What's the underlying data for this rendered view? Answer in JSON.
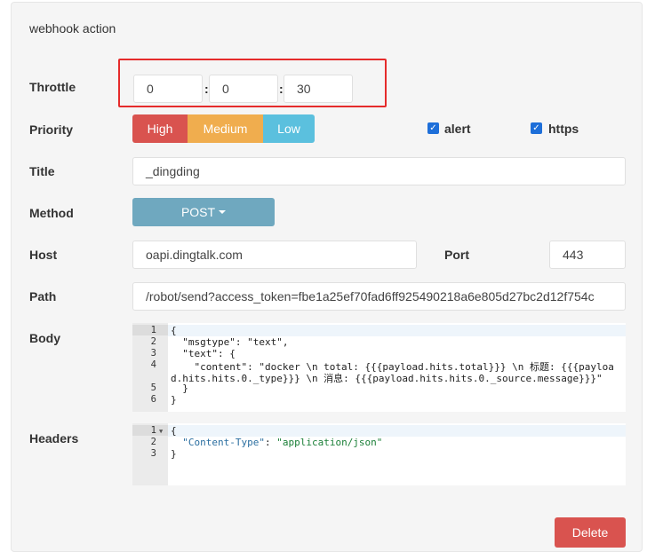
{
  "panel": {
    "title": "webhook action"
  },
  "throttle": {
    "label": "Throttle",
    "hours": "0",
    "minutes": "0",
    "seconds": "30",
    "separator": ":"
  },
  "priority": {
    "label": "Priority",
    "options": [
      "High",
      "Medium",
      "Low"
    ],
    "colors": {
      "high": "#d9534f",
      "medium": "#f0ad4e",
      "low": "#5bc0de"
    }
  },
  "alert": {
    "label": "alert",
    "checked": true
  },
  "https": {
    "label": "https",
    "checked": true
  },
  "title": {
    "label": "Title",
    "value": "_dingding"
  },
  "method": {
    "label": "Method",
    "value": "POST"
  },
  "host": {
    "label": "Host",
    "value": "oapi.dingtalk.com"
  },
  "port": {
    "label": "Port",
    "value": "443"
  },
  "path": {
    "label": "Path",
    "value": "/robot/send?access_token=fbe1a25ef70fad6ff925490218a6e805d27bc2d12f754c"
  },
  "body": {
    "label": "Body",
    "line_numbers": [
      "1",
      "2",
      "3",
      "4",
      "",
      "5",
      "6"
    ],
    "lines": [
      "{",
      "  \"msgtype\": \"text\",",
      "  \"text\": {",
      "    \"content\": \"docker \\n total: {{{payload.hits.total}}} \\n 标题: {{{payloa",
      "d.hits.hits.0._type}}} \\n 消息: {{{payload.hits.hits.0._source.message}}}\"",
      "  }",
      "}"
    ]
  },
  "headers": {
    "label": "Headers",
    "line_numbers": [
      "1",
      "2",
      "3"
    ],
    "fold_icon": "chevron-down-icon",
    "lines": [
      "{",
      "  \"Content-Type\": \"application/json\"",
      "}"
    ],
    "key": "\"Content-Type\"",
    "sep": ": ",
    "value": "\"application/json\""
  },
  "delete_button": {
    "label": "Delete"
  }
}
